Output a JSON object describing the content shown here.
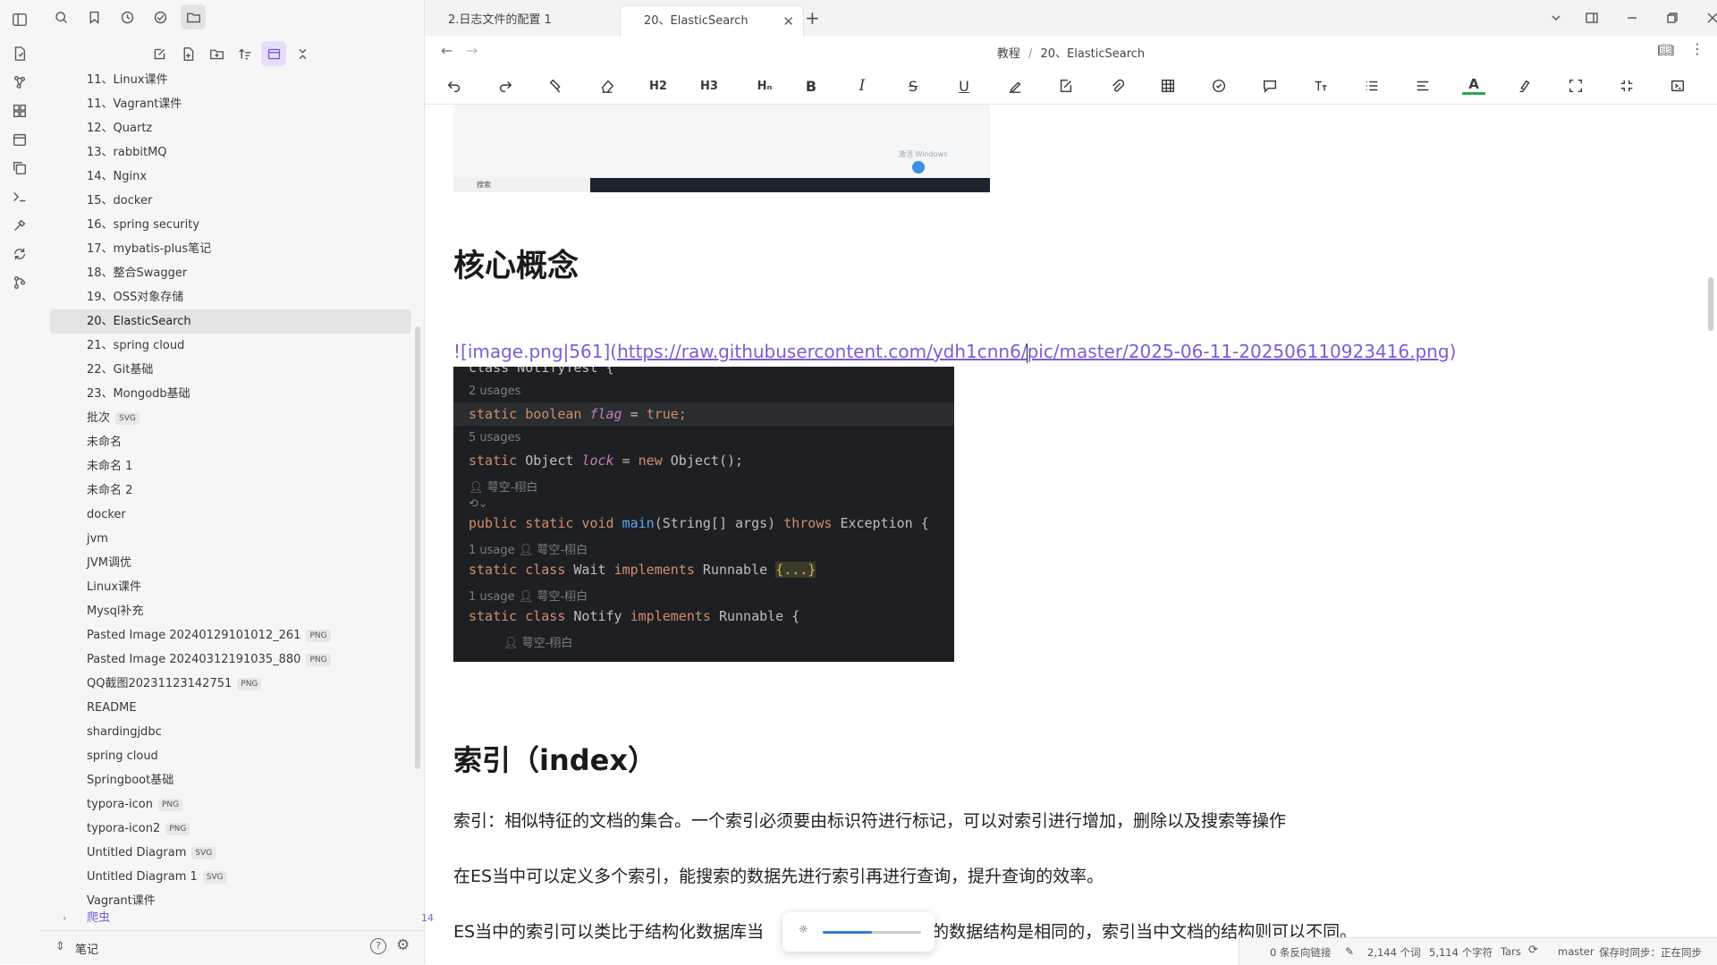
{
  "sidebar": {
    "items": [
      {
        "label": "11、Linux课件",
        "badge": ""
      },
      {
        "label": "11、Vagrant课件",
        "badge": ""
      },
      {
        "label": "12、Quartz",
        "badge": ""
      },
      {
        "label": "13、rabbitMQ",
        "badge": ""
      },
      {
        "label": "14、Nginx",
        "badge": ""
      },
      {
        "label": "15、docker",
        "badge": ""
      },
      {
        "label": "16、spring security",
        "badge": ""
      },
      {
        "label": "17、mybatis-plus笔记",
        "badge": ""
      },
      {
        "label": "18、整合Swagger",
        "badge": ""
      },
      {
        "label": "19、OSS对象存储",
        "badge": ""
      },
      {
        "label": "20、ElasticSearch",
        "badge": ""
      },
      {
        "label": "21、spring cloud",
        "badge": ""
      },
      {
        "label": "22、Git基础",
        "badge": ""
      },
      {
        "label": "23、Mongodb基础",
        "badge": ""
      },
      {
        "label": "批次",
        "badge": "SVG"
      },
      {
        "label": "未命名",
        "badge": ""
      },
      {
        "label": "未命名 1",
        "badge": ""
      },
      {
        "label": "未命名 2",
        "badge": ""
      },
      {
        "label": "docker",
        "badge": ""
      },
      {
        "label": "jvm",
        "badge": ""
      },
      {
        "label": "JVM调优",
        "badge": ""
      },
      {
        "label": "Linux课件",
        "badge": ""
      },
      {
        "label": "Mysql补充",
        "badge": ""
      },
      {
        "label": "Pasted Image 20240129101012_261",
        "badge": "PNG"
      },
      {
        "label": "Pasted Image 20240312191035_880",
        "badge": "PNG"
      },
      {
        "label": "QQ截图20231123142751",
        "badge": "PNG"
      },
      {
        "label": "README",
        "badge": ""
      },
      {
        "label": "shardingjdbc",
        "badge": ""
      },
      {
        "label": "spring cloud",
        "badge": ""
      },
      {
        "label": "Springboot基础",
        "badge": ""
      },
      {
        "label": "typora-icon",
        "badge": "PNG"
      },
      {
        "label": "typora-icon2",
        "badge": "PNG"
      },
      {
        "label": "Untitled Diagram",
        "badge": "SVG"
      },
      {
        "label": "Untitled Diagram 1",
        "badge": "SVG"
      },
      {
        "label": "Vagrant课件",
        "badge": ""
      }
    ],
    "folder": {
      "label": "爬虫",
      "count": "14"
    },
    "vault_name": "笔记"
  },
  "tabs": [
    {
      "label": "2.日志文件的配置 1"
    },
    {
      "label": "20、ElasticSearch"
    }
  ],
  "breadcrumb": {
    "parent": "教程",
    "sep": "/",
    "current": "20、ElasticSearch"
  },
  "toolbar": {
    "h2": "H2",
    "h3": "H3",
    "hn": "Hₙ",
    "bold": "B",
    "italic": "I",
    "strike": "S",
    "underline": "U",
    "textcolor": "A"
  },
  "content": {
    "heading1": "核心概念",
    "link_prefix": "![image.png|561](",
    "link_url_a": "https://raw.githubusercontent.com/ydh1cnn6/",
    "link_url_b": "pic/master/2025-06-11-202506110923416.png",
    "link_suffix": ")",
    "heading2": "索引（index）",
    "p1": "索引：相似特征的文档的集合。一个索引必须要由标识符进行标记，可以对索引进行增加，删除以及搜索等操作",
    "p2": "在ES当中可以定义多个索引，能搜索的数据先进行索引再进行查询，提升查询的效率。",
    "p3a": "ES当中的索引可以类比于结构化数据库当",
    "p3b": "当中所有的数据结构是相同的，索引当中文档的结构则可以不同。"
  },
  "code_image": {
    "l0": "class NotifyTest {",
    "c1": "2 usages",
    "l1_kw": "static boolean ",
    "l1_it": "flag",
    "l1_rest": " = ",
    "l1_val": "true;",
    "c2": "5 usages",
    "l2_kw": "static ",
    "l2_type": "Object ",
    "l2_it": "lock",
    "l2_rest": " = ",
    "l2_new": "new ",
    "l2_tail": "Object();",
    "author": "萼空-栩白",
    "l3_kw": "public static void ",
    "l3_fn": "main",
    "l3_rest": "(String[] args) ",
    "l3_kw2": "throws ",
    "l3_tail": "Exception {",
    "c3": "1 usage",
    "l4_kw": "static class ",
    "l4_name": "Wait ",
    "l4_kw2": "implements ",
    "l4_tail": "Runnable ",
    "l4_fold": "{...}",
    "l5_kw": "static class ",
    "l5_name": "Notify ",
    "l5_kw2": "implements ",
    "l5_tail": "Runnable {"
  },
  "screenshot_image": {
    "taskbar_text": "搜索",
    "watermark": "激活 Windows"
  },
  "status": {
    "backlinks": "0 条反向链接",
    "words": "2,144 个词",
    "chars": "5,114 个字符",
    "author": "Tars",
    "branch": "master",
    "sync": "保存时同步：正在同步"
  },
  "zoom": {
    "level": 0.5
  }
}
